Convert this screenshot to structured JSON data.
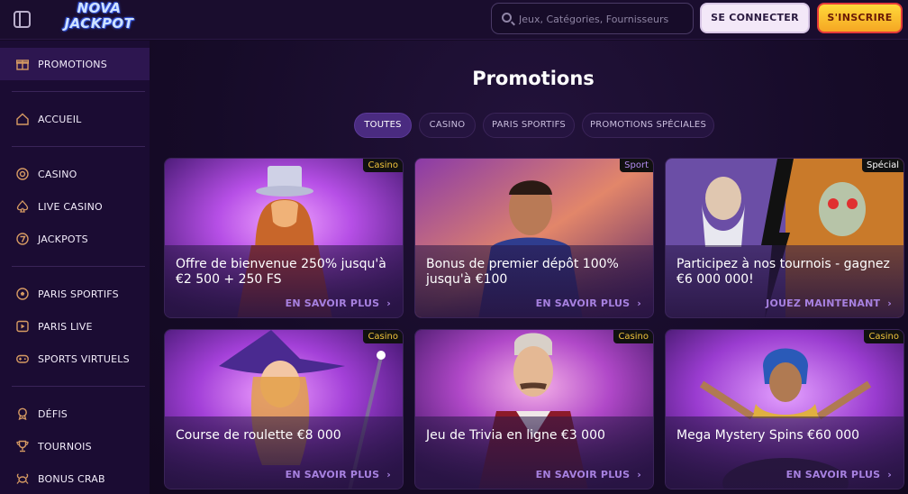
{
  "header": {
    "logo_line1": "NOVA",
    "logo_line2": "JACKPOT",
    "search_placeholder": "Jeux, Catégories, Fournisseurs",
    "login_label": "SE CONNECTER",
    "signup_label": "S'INSCRIRE"
  },
  "sidebar": {
    "items": [
      {
        "label": "PROMOTIONS",
        "icon": "gift-box-icon"
      },
      {
        "label": "ACCUEIL",
        "icon": "home-icon"
      },
      {
        "label": "CASINO",
        "icon": "casino-chip-icon"
      },
      {
        "label": "LIVE CASINO",
        "icon": "spade-icon"
      },
      {
        "label": "JACKPOTS",
        "icon": "seven-icon"
      },
      {
        "label": "PARIS SPORTIFS",
        "icon": "football-icon"
      },
      {
        "label": "PARIS LIVE",
        "icon": "play-icon"
      },
      {
        "label": "SPORTS VIRTUELS",
        "icon": "gamepad-icon"
      },
      {
        "label": "DÉFIS",
        "icon": "medal-icon"
      },
      {
        "label": "TOURNOIS",
        "icon": "trophy-icon"
      },
      {
        "label": "BONUS CRAB",
        "icon": "crab-icon"
      }
    ]
  },
  "main": {
    "title": "Promotions",
    "tabs": [
      {
        "label": "TOUTES",
        "active": true
      },
      {
        "label": "CASINO",
        "active": false
      },
      {
        "label": "PARIS SPORTIFS",
        "active": false
      },
      {
        "label": "PROMOTIONS SPÉCIALES",
        "active": false
      }
    ],
    "cards": [
      {
        "category": "Casino",
        "title": "Offre de bienvenue 250% jusqu'à €2 500 + 250 FS",
        "cta": "EN SAVOIR PLUS"
      },
      {
        "category": "Sport",
        "title": "Bonus de premier dépôt 100% jusqu'à €100",
        "cta": "EN SAVOIR PLUS"
      },
      {
        "category": "Spécial",
        "title": "Participez à nos tournois - gagnez €6 000 000!",
        "cta": "JOUEZ MAINTENANT"
      },
      {
        "category": "Casino",
        "title": "Course de roulette €8 000",
        "cta": "EN SAVOIR PLUS"
      },
      {
        "category": "Casino",
        "title": "Jeu de Trivia en ligne €3 000",
        "cta": "EN SAVOIR PLUS"
      },
      {
        "category": "Casino",
        "title": "Mega Mystery Spins €60 000",
        "cta": "EN SAVOIR PLUS"
      }
    ]
  },
  "colors": {
    "accent": "#a781e0",
    "signup_yellow": "#ffd93a",
    "casino_badge": "#f0c43b",
    "sidebar_icon": "#d69a63"
  }
}
